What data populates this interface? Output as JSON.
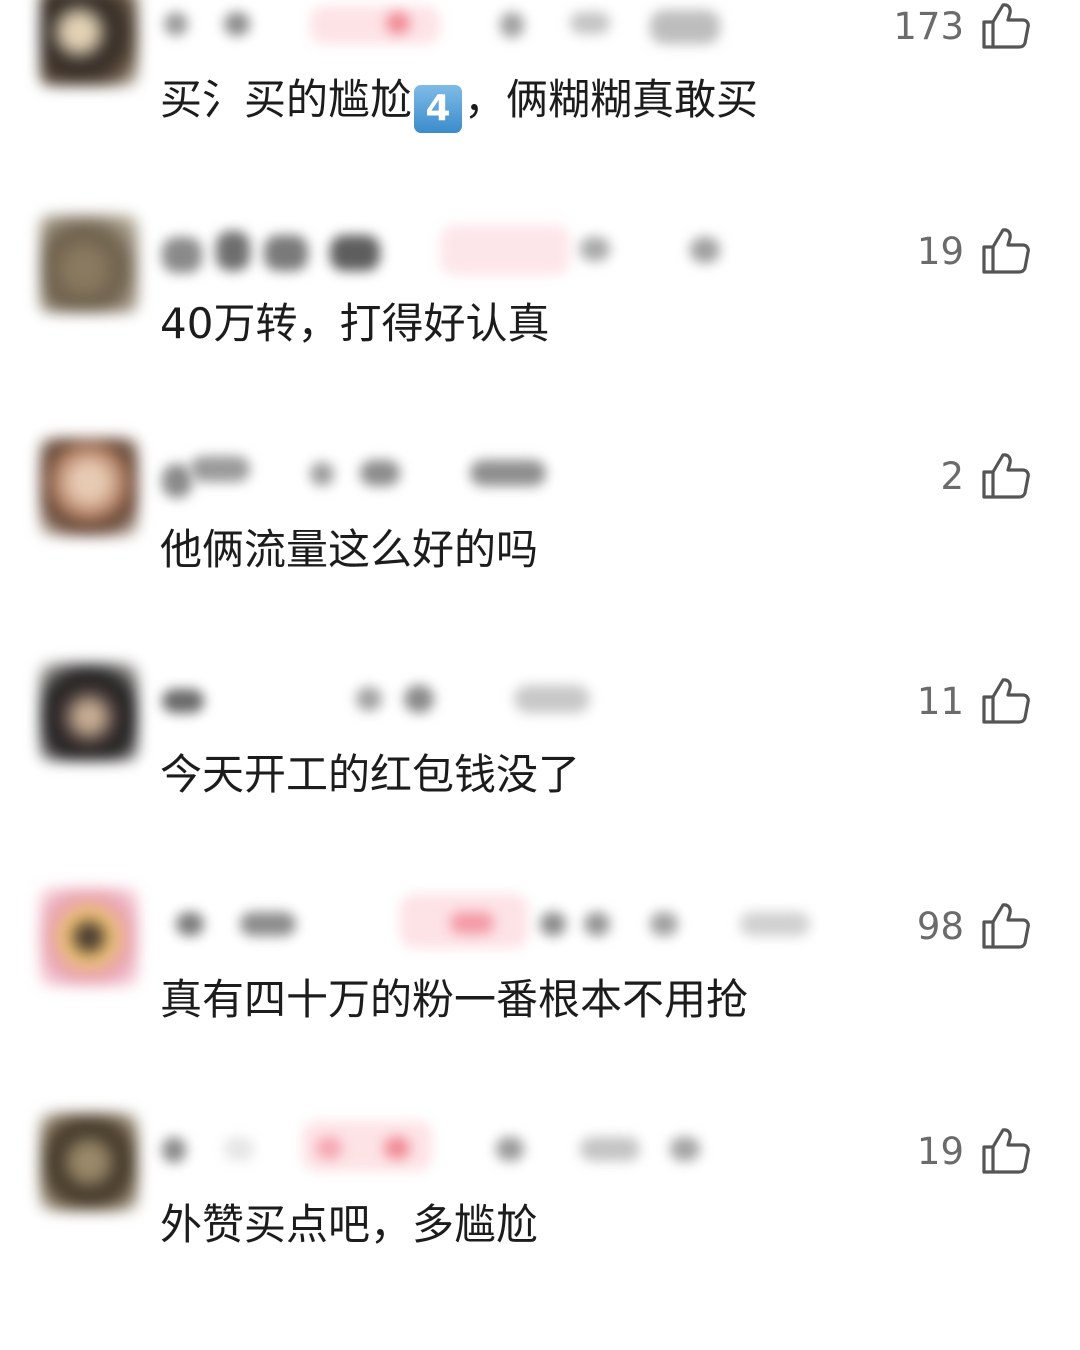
{
  "comments": [
    {
      "text_before": "买氵买的尴尬",
      "keycap": "4️⃣",
      "text_after": "，俩糊糊真敢买",
      "likes": "173",
      "avatar_colors": [
        "#2b2420",
        "#d9c8a8"
      ],
      "like_icon": "thumbs-up-icon"
    },
    {
      "text": "40万转，打得好认真",
      "likes": "19",
      "avatar_colors": [
        "#6b5e4a",
        "#a39279"
      ],
      "like_icon": "thumbs-up-icon"
    },
    {
      "text": "他俩流量这么好的吗",
      "likes": "2",
      "avatar_colors": [
        "#c49a7c",
        "#6e4a3a"
      ],
      "like_icon": "thumbs-up-icon"
    },
    {
      "text": "今天开工的红包钱没了",
      "likes": "11",
      "avatar_colors": [
        "#1f1f1f",
        "#b39a84"
      ],
      "like_icon": "thumbs-up-icon"
    },
    {
      "text": "真有四十万的粉一番根本不用抢",
      "likes": "98",
      "avatar_colors": [
        "#e8a0b0",
        "#f0c870"
      ],
      "like_icon": "thumbs-up-icon"
    },
    {
      "text": "外赞买点吧，多尴尬",
      "likes": "19",
      "avatar_colors": [
        "#3a3024",
        "#9b8a6a"
      ],
      "like_icon": "thumbs-up-icon"
    }
  ]
}
